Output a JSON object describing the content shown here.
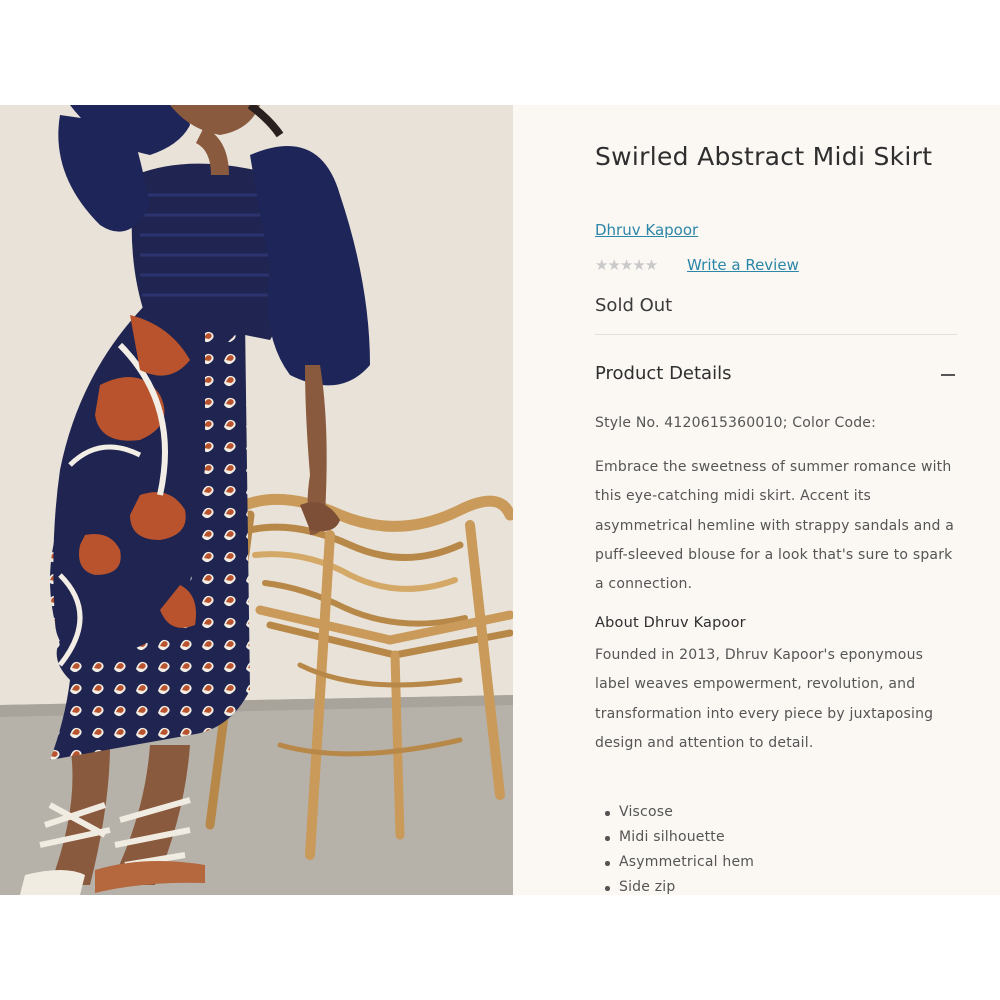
{
  "product": {
    "title": "Swirled Abstract Midi Skirt",
    "brand_link": "Dhruv Kapoor",
    "rating": {
      "stars": "★★★★★",
      "filled": 0,
      "out_of": 5
    },
    "review_link": "Write a Review",
    "status": "Sold Out"
  },
  "details": {
    "heading": "Product Details",
    "toggle_icon": "minus-icon",
    "style_line": "Style No. 4120615360010; Color Code:",
    "description": "Embrace the sweetness of summer romance with this eye-catching midi skirt. Accent its asymmetrical hemline with strappy sandals and a puff-sleeved blouse for a look that's sure to spark a connection.",
    "about_heading": "About Dhruv Kapoor",
    "about_text": "Founded in 2013, Dhruv Kapoor's eponymous label weaves empowerment, revolution, and transformation into every piece by juxtaposing design and attention to detail.",
    "features": [
      "Viscose",
      "Midi silhouette",
      "Asymmetrical hem",
      "Side zip"
    ]
  },
  "colors": {
    "link": "#2b86a8",
    "panel_bg": "#fbf8f4",
    "navy": "#1f2550",
    "rust": "#b8532e",
    "rattan": "#c99a5a"
  }
}
